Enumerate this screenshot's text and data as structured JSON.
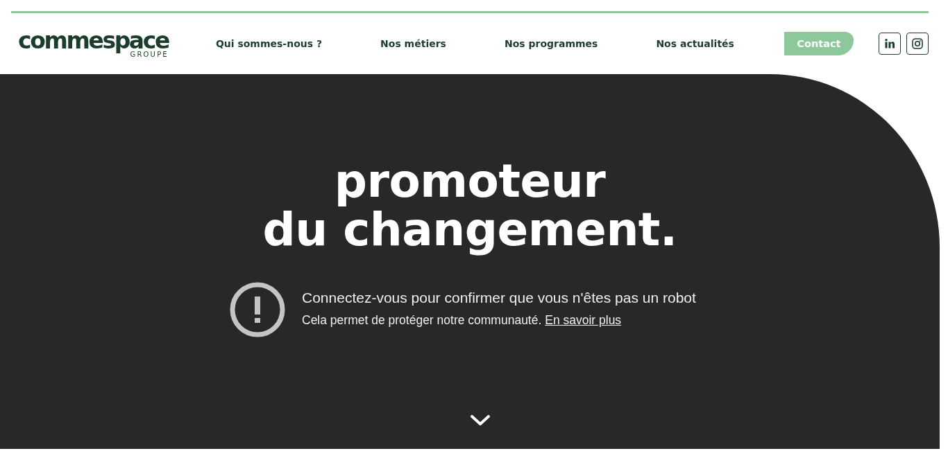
{
  "header": {
    "logo": {
      "name": "commespace",
      "tagline": "GROUPE"
    },
    "nav": [
      {
        "label": "Qui sommes-nous ?",
        "kind": "link"
      },
      {
        "label": "Nos métiers",
        "kind": "link"
      },
      {
        "label": "Nos programmes",
        "kind": "link"
      },
      {
        "label": "Nos actualités",
        "kind": "link"
      },
      {
        "label": "Contact",
        "kind": "button"
      }
    ],
    "social": [
      {
        "kind": "linkedin"
      },
      {
        "kind": "instagram"
      }
    ]
  },
  "hero": {
    "heading": [
      "promoteur",
      "du changement."
    ],
    "notice": {
      "title": "Connectez-vous pour confirmer que vous n'êtes pas un robot",
      "text": "Cela permet de protéger notre communauté.",
      "link": "En savoir plus"
    }
  }
}
